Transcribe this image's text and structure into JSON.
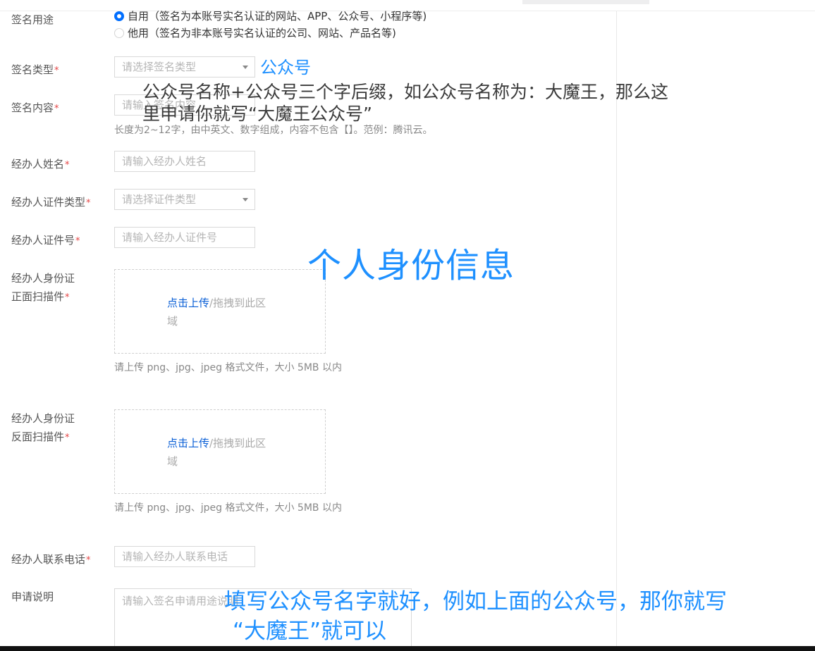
{
  "form": {
    "usage": {
      "label": "签名用途",
      "options": [
        {
          "text": "自用（签名为本账号实名认证的网站、APP、公众号、小程序等)",
          "checked": true
        },
        {
          "text": "他用（签名为非本账号实名认证的公司、网站、产品名等)",
          "checked": false
        }
      ]
    },
    "sign_type": {
      "label": "签名类型",
      "placeholder": "请选择签名类型"
    },
    "sign_content": {
      "label": "签名内容",
      "placeholder": "请输入签名内容",
      "hint": "长度为2~12字，由中英文、数字组成，内容不包含【】。范例：腾讯云。"
    },
    "agent_name": {
      "label": "经办人姓名",
      "placeholder": "请输入经办人姓名"
    },
    "agent_id_type": {
      "label": "经办人证件类型",
      "placeholder": "请选择证件类型"
    },
    "agent_id_number": {
      "label": "经办人证件号",
      "placeholder": "请输入经办人证件号"
    },
    "id_front": {
      "label_line1": "经办人身份证",
      "label_line2": "正面扫描件",
      "upload_link": "点击上传",
      "upload_rest": "/拖拽到此区域",
      "hint": "请上传 png、jpg、jpeg 格式文件，大小 5MB 以内"
    },
    "id_back": {
      "label_line1": "经办人身份证",
      "label_line2": "反面扫描件",
      "upload_link": "点击上传",
      "upload_rest": "/拖拽到此区域",
      "hint": "请上传 png、jpg、jpeg 格式文件，大小 5MB 以内"
    },
    "agent_phone": {
      "label": "经办人联系电话",
      "placeholder": "请输入经办人联系电话"
    },
    "apply_note": {
      "label": "申请说明",
      "placeholder": "请输入签名申请用途说明"
    },
    "required_mark": "*"
  },
  "annotations": {
    "gzh": "公众号",
    "gzh_explain_line1": "公众号名称+公众号三个字后缀，如公众号名称为：大魔王，那么这",
    "gzh_explain_line2": "里申请你就写“大魔王公众号”",
    "id_info": "个人身份信息",
    "bottom_line1": "填写公众号名字就好，例如上面的公众号，那你就写",
    "bottom_line2": "“大魔王”就可以"
  },
  "colors": {
    "accent": "#006eff",
    "annotation_blue": "#1e90ff",
    "required_red": "#e54545",
    "link_blue": "#0a5fd6"
  }
}
